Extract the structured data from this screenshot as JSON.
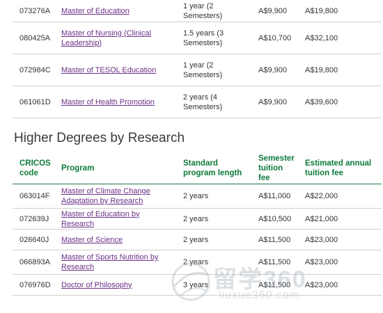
{
  "coursework_programs": [
    {
      "code": "073276A",
      "program": "Master of Education",
      "length": "1 year (2 Semesters)",
      "semester_fee": "A$9,900",
      "annual_fee": "A$19,800"
    },
    {
      "code": "080425A",
      "program": "Master of Nursing (Clinical Leadership)",
      "length": "1.5 years (3 Semesters)",
      "semester_fee": "A$10,700",
      "annual_fee": "A$32,100"
    },
    {
      "code": "072984C",
      "program": "Master of TESOL Education",
      "length": "1 year (2 Semesters)",
      "semester_fee": "A$9,900",
      "annual_fee": "A$19,800"
    },
    {
      "code": "061061D",
      "program": "Master of Health Promotion",
      "length": "2 years (4 Semesters)",
      "semester_fee": "A$9,900",
      "annual_fee": "A$39,600"
    }
  ],
  "research": {
    "title": "Higher Degrees by Research",
    "headers": {
      "code": "CRICOS code",
      "program": "Program",
      "length": "Standard program length",
      "semester_fee": "Semester tuition fee",
      "annual_fee": "Estimated annual tuition fee"
    },
    "rows": [
      {
        "code": "063014F",
        "program": "Master of Climate Change Adaptation by Research",
        "length": "2 years",
        "semester_fee": "A$11,000",
        "annual_fee": "A$22,000"
      },
      {
        "code": "072639J",
        "program": "Master of Education by Research",
        "length": "2 years",
        "semester_fee": "A$10,500",
        "annual_fee": "A$21,000"
      },
      {
        "code": "026640J",
        "program": "Master of Science",
        "length": "2 years",
        "semester_fee": "A$11,500",
        "annual_fee": "A$23,000"
      },
      {
        "code": "066893A",
        "program": "Master of Sports Nutrition by Research",
        "length": "2 years",
        "semester_fee": "A$11,500",
        "annual_fee": "A$23,000"
      },
      {
        "code": "076976D",
        "program": "Doctor of Philosophy",
        "length": "3 years",
        "semester_fee": "A$11,500",
        "annual_fee": "A$23,000"
      }
    ]
  },
  "watermark": {
    "main": "留学360",
    "sub": "liuxue360.com"
  },
  "colors": {
    "link": "#6b2f86",
    "header": "#0d7a3c",
    "divider": "#cfcfcf"
  }
}
